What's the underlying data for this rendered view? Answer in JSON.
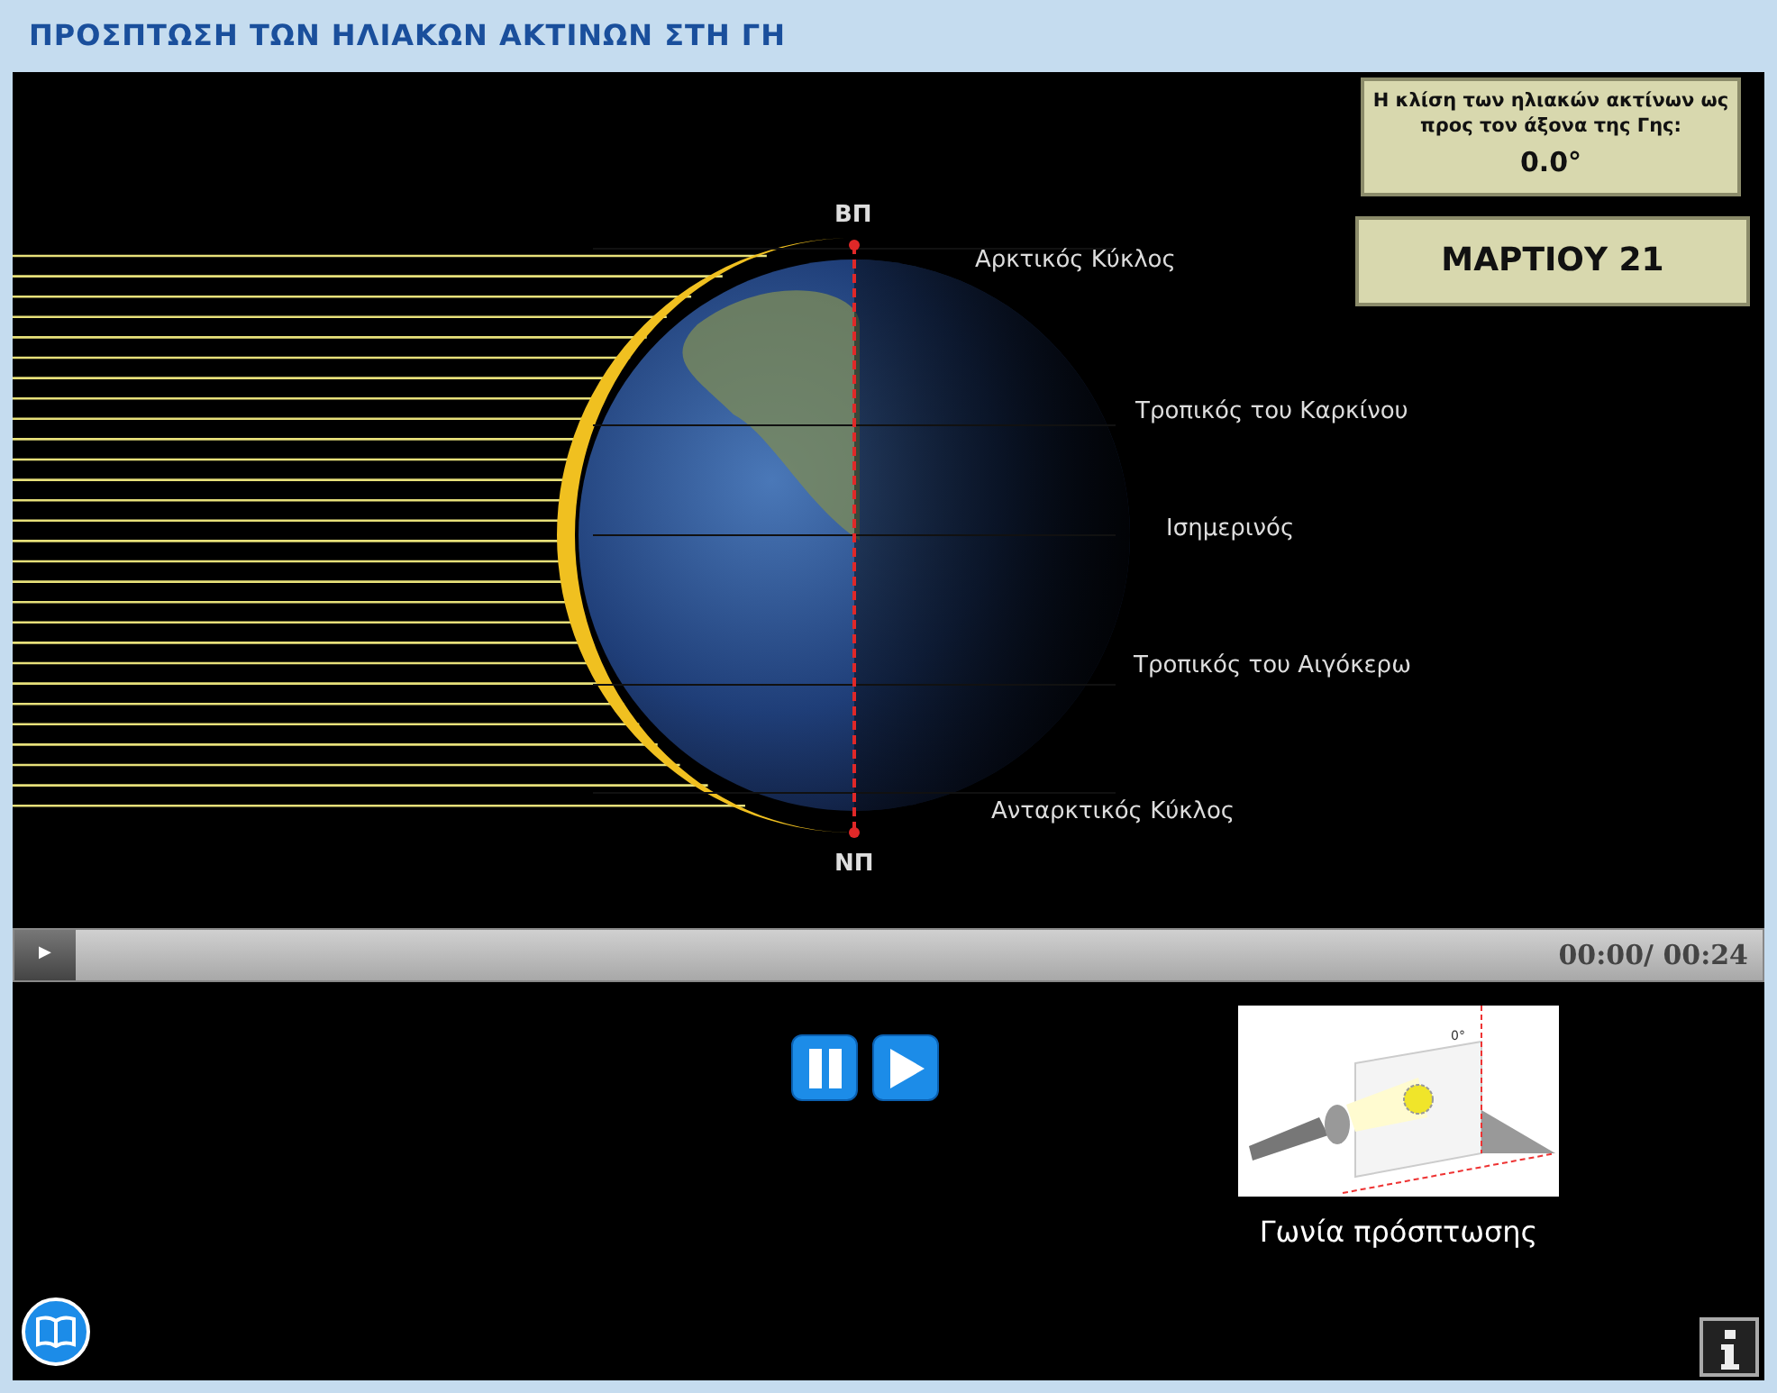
{
  "title": "ΠΡΟΣΠΤΩΣΗ ΤΩΝ ΗΛΙΑΚΩΝ ΑΚΤΙΝΩΝ ΣΤΗ ΓΗ",
  "animation": {
    "pole_labels": [
      "ΒΠ",
      "ΝΠ"
    ],
    "circle_labels": [
      "Αρκτικός Κύκλος",
      "Τροπικός του Καρκίνου",
      "Ισημερινός",
      "Τροπικός του Αιγόκερω",
      "Ανταρκτικός Κύκλος"
    ],
    "angle_panel": {
      "caption": "Η κλίση των ηλιακών ακτίνων ως προς τον άξονα της Γης:",
      "value": "0.0°"
    },
    "date": "ΜΑΡΤΙΟΥ 21"
  },
  "player": {
    "play_symbol": "▶",
    "time": "00:00/ 00:24"
  },
  "thumbnail": {
    "angle": "0°",
    "caption": "Γωνία πρόσπτωσης"
  }
}
